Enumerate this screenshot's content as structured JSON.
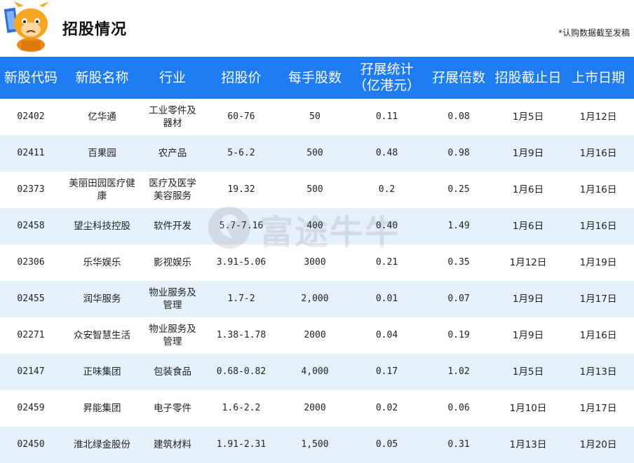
{
  "header": {
    "title": "招股情况",
    "note": "*认购数据截至发稿"
  },
  "watermark": {
    "text": "富途牛牛"
  },
  "table": {
    "columns": [
      "新股代码",
      "新股名称",
      "行业",
      "招股价",
      "每手股数",
      "孖展统计（亿港元）",
      "孖展倍数",
      "招股截止日",
      "上市日期"
    ],
    "column_lines": [
      [
        "新股代码"
      ],
      [
        "新股名称"
      ],
      [
        "行业"
      ],
      [
        "招股价"
      ],
      [
        "每手股数"
      ],
      [
        "孖展统计",
        "（亿港元）"
      ],
      [
        "孖展倍数"
      ],
      [
        "招股截止日"
      ],
      [
        "上市日期"
      ]
    ],
    "rows": [
      [
        "02402",
        "亿华通",
        "工业零件及器材",
        "60-76",
        "50",
        "0.11",
        "0.08",
        "1月5日",
        "1月12日"
      ],
      [
        "02411",
        "百果园",
        "农产品",
        "5-6.2",
        "500",
        "0.48",
        "0.98",
        "1月9日",
        "1月16日"
      ],
      [
        "02373",
        "美丽田园医疗健康",
        "医疗及医学美容服务",
        "19.32",
        "500",
        "0.2",
        "0.25",
        "1月6日",
        "1月16日"
      ],
      [
        "02458",
        "望尘科技控股",
        "软件开发",
        "5.7-7.16",
        "400",
        "0.40",
        "1.49",
        "1月6日",
        "1月16日"
      ],
      [
        "02306",
        "乐华娱乐",
        "影视娱乐",
        "3.91-5.06",
        "3000",
        "0.21",
        "0.35",
        "1月12日",
        "1月19日"
      ],
      [
        "02455",
        "润华服务",
        "物业服务及管理",
        "1.7-2",
        "2,000",
        "0.01",
        "0.07",
        "1月9日",
        "1月17日"
      ],
      [
        "02271",
        "众安智慧生活",
        "物业服务及管理",
        "1.38-1.78",
        "2000",
        "0.04",
        "0.19",
        "1月9日",
        "1月16日"
      ],
      [
        "02147",
        "正味集团",
        "包装食品",
        "0.68-0.82",
        "4,000",
        "0.17",
        "1.02",
        "1月5日",
        "1月13日"
      ],
      [
        "02459",
        "昇能集团",
        "电子零件",
        "1.6-2.2",
        "2000",
        "0.02",
        "0.06",
        "1月10日",
        "1月17日"
      ],
      [
        "02450",
        "淮北绿金股份",
        "建筑材料",
        "1.91-2.31",
        "1,500",
        "0.05",
        "0.31",
        "1月13日",
        "1月20日"
      ]
    ]
  },
  "colors": {
    "header_bg": "#1f7bf0",
    "row_alt_bg": "#e6f0fb",
    "mascot_orange": "#f5a623"
  }
}
